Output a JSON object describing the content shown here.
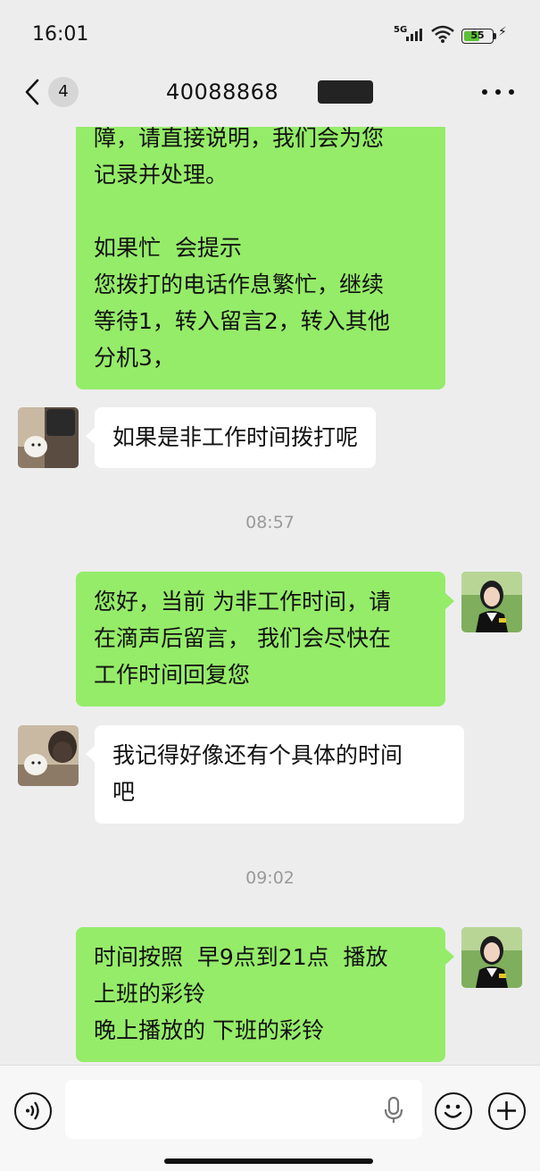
{
  "status_bar": {
    "time": "16:01",
    "network": "5G",
    "battery": "55",
    "battery_level": 0.55
  },
  "header": {
    "unread_count": "4",
    "title": "40088868"
  },
  "messages": [
    {
      "sender": "me",
      "text": "障，请直接说明，我们会为您\n记录并处理。\n\n如果忙  会提示\n您拨打的电话作息繁忙，继续\n等待1，转入留言2，转入其他\n分机3，"
    },
    {
      "sender": "them",
      "text": "如果是非工作时间拨打呢"
    },
    {
      "type": "timestamp",
      "text": "08:57"
    },
    {
      "sender": "me",
      "text": "您好，当前 为非工作时间，请\n在滴声后留言， 我们会尽快在\n工作时间回复您"
    },
    {
      "sender": "them",
      "text": "我记得好像还有个具体的时间\n吧"
    },
    {
      "type": "timestamp",
      "text": "09:02"
    },
    {
      "sender": "me",
      "text": "时间按照  早9点到21点  播放\n上班的彩铃\n晚上播放的 下班的彩铃"
    }
  ],
  "input_bar": {
    "placeholder": ""
  },
  "colors": {
    "background": "#ededed",
    "my_bubble": "#95ec69",
    "their_bubble": "#ffffff",
    "timestamp": "#9a9a9a",
    "battery_fill": "#5bc236"
  },
  "icons": {
    "back": "chevron-left-icon",
    "more": "more-horizontal-icon",
    "voice": "voice-icon",
    "mic": "mic-icon",
    "emoji": "emoji-icon",
    "add": "plus-icon"
  }
}
